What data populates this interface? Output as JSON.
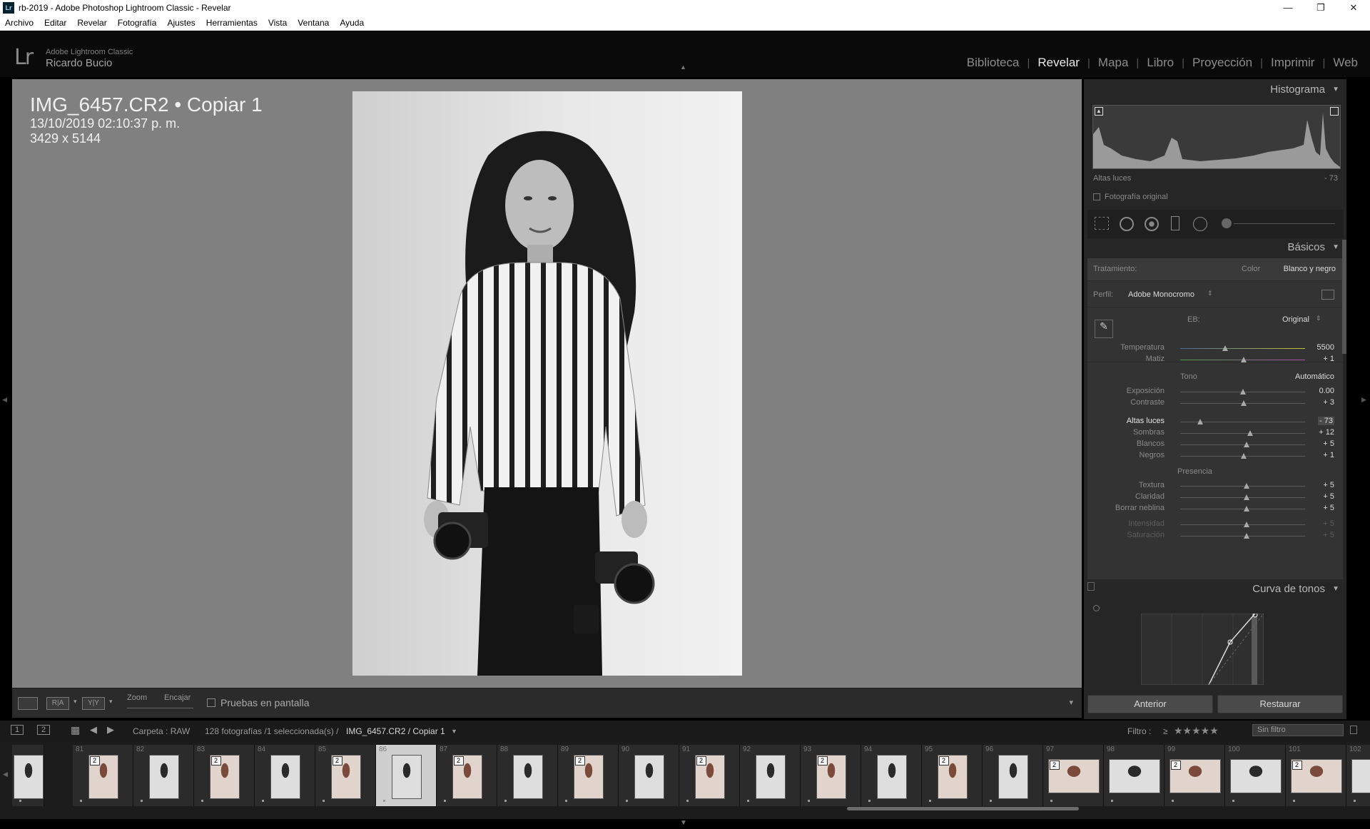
{
  "window": {
    "title": "rb-2019 - Adobe Photoshop Lightroom Classic - Revelar",
    "app_icon": "Lr",
    "min": "—",
    "restore": "❐",
    "close": "✕"
  },
  "menu": [
    "Archivo",
    "Editar",
    "Revelar",
    "Fotografía",
    "Ajustes",
    "Herramientas",
    "Vista",
    "Ventana",
    "Ayuda"
  ],
  "identity": {
    "logo": "Lr",
    "app_name": "Adobe Lightroom Classic",
    "user": "Ricardo Bucio"
  },
  "modules": [
    {
      "label": "Biblioteca",
      "active": false
    },
    {
      "label": "Revelar",
      "active": true
    },
    {
      "label": "Mapa",
      "active": false
    },
    {
      "label": "Libro",
      "active": false
    },
    {
      "label": "Proyección",
      "active": false
    },
    {
      "label": "Imprimir",
      "active": false
    },
    {
      "label": "Web",
      "active": false
    }
  ],
  "photo": {
    "filename": "IMG_6457.CR2  •  Copiar 1",
    "datetime": "13/10/2019 02:10:37 p. m.",
    "dimensions": "3429 x 5144"
  },
  "toolbar": {
    "view_ra": "R|A",
    "view_yy": "Y|Y",
    "zoom_label": "Zoom",
    "fit_label": "Encajar",
    "softproof_label": "Pruebas en pantalla"
  },
  "histogram": {
    "title": "Histograma",
    "readout_label": "Altas luces",
    "readout_value": "- 73",
    "original_label": "Fotografía original"
  },
  "basics": {
    "title": "Básicos",
    "treatment_label": "Tratamiento:",
    "treatment_color": "Color",
    "treatment_bw": "Blanco y negro",
    "profile_label": "Perfil:",
    "profile_value": "Adobe Monocromo",
    "wb_label": "EB:",
    "wb_value": "Original",
    "tone_label": "Tono",
    "auto_label": "Automático",
    "presence_label": "Presencia",
    "sliders": [
      {
        "label": "Temperatura",
        "value": "5500",
        "pos": 0.36,
        "dim": false,
        "active": false
      },
      {
        "label": "Matiz",
        "value": "+ 1",
        "pos": 0.51,
        "dim": false,
        "active": false
      },
      {
        "label": "Exposición",
        "value": "0.00",
        "pos": 0.5,
        "dim": false,
        "active": false
      },
      {
        "label": "Contraste",
        "value": "+ 3",
        "pos": 0.51,
        "dim": false,
        "active": false
      },
      {
        "label": "Altas luces",
        "value": "- 73",
        "pos": 0.16,
        "dim": false,
        "active": true
      },
      {
        "label": "Sombras",
        "value": "+ 12",
        "pos": 0.56,
        "dim": false,
        "active": false
      },
      {
        "label": "Blancos",
        "value": "+ 5",
        "pos": 0.53,
        "dim": false,
        "active": false
      },
      {
        "label": "Negros",
        "value": "+ 1",
        "pos": 0.51,
        "dim": false,
        "active": false
      },
      {
        "label": "Textura",
        "value": "+ 5",
        "pos": 0.53,
        "dim": false,
        "active": false
      },
      {
        "label": "Claridad",
        "value": "+ 5",
        "pos": 0.53,
        "dim": false,
        "active": false
      },
      {
        "label": "Borrar neblina",
        "value": "+ 5",
        "pos": 0.53,
        "dim": false,
        "active": false
      },
      {
        "label": "Intensidad",
        "value": "+ 5",
        "pos": 0.53,
        "dim": true,
        "active": false
      },
      {
        "label": "Saturación",
        "value": "+ 5",
        "pos": 0.53,
        "dim": true,
        "active": false
      }
    ]
  },
  "curve": {
    "title": "Curva de tonos"
  },
  "buttons": {
    "previous": "Anterior",
    "reset": "Restaurar"
  },
  "filmbar": {
    "screen1": "1",
    "screen2": "2",
    "folder": "Carpeta : RAW",
    "count": "128 fotografías /1 seleccionada(s) /",
    "current": "IMG_6457.CR2 / Copiar 1",
    "filter_label": "Filtro :",
    "filter_op": "≥",
    "stars": "★★★★★",
    "filter_value": "Sin filtro"
  },
  "filmstrip": [
    {
      "num": "",
      "badge": "",
      "color": false,
      "selected": false
    },
    {
      "num": "81",
      "badge": "2",
      "color": true,
      "selected": false
    },
    {
      "num": "82",
      "badge": "",
      "color": false,
      "selected": false
    },
    {
      "num": "83",
      "badge": "2",
      "color": true,
      "selected": false
    },
    {
      "num": "84",
      "badge": "",
      "color": false,
      "selected": false
    },
    {
      "num": "85",
      "badge": "2",
      "color": true,
      "selected": false
    },
    {
      "num": "86",
      "badge": "",
      "color": false,
      "selected": true
    },
    {
      "num": "87",
      "badge": "2",
      "color": true,
      "selected": false
    },
    {
      "num": "88",
      "badge": "",
      "color": false,
      "selected": false
    },
    {
      "num": "89",
      "badge": "2",
      "color": true,
      "selected": false
    },
    {
      "num": "90",
      "badge": "",
      "color": false,
      "selected": false
    },
    {
      "num": "91",
      "badge": "2",
      "color": true,
      "selected": false
    },
    {
      "num": "92",
      "badge": "",
      "color": false,
      "selected": false
    },
    {
      "num": "93",
      "badge": "2",
      "color": true,
      "selected": false
    },
    {
      "num": "94",
      "badge": "",
      "color": false,
      "selected": false
    },
    {
      "num": "95",
      "badge": "2",
      "color": true,
      "selected": false
    },
    {
      "num": "96",
      "badge": "",
      "color": false,
      "selected": false
    },
    {
      "num": "97",
      "badge": "2",
      "color": true,
      "selected": false
    },
    {
      "num": "98",
      "badge": "",
      "color": false,
      "selected": false
    },
    {
      "num": "99",
      "badge": "2",
      "color": true,
      "selected": false
    },
    {
      "num": "100",
      "badge": "",
      "color": false,
      "selected": false
    },
    {
      "num": "101",
      "badge": "2",
      "color": true,
      "selected": false
    },
    {
      "num": "102",
      "badge": "",
      "color": false,
      "selected": false
    }
  ]
}
